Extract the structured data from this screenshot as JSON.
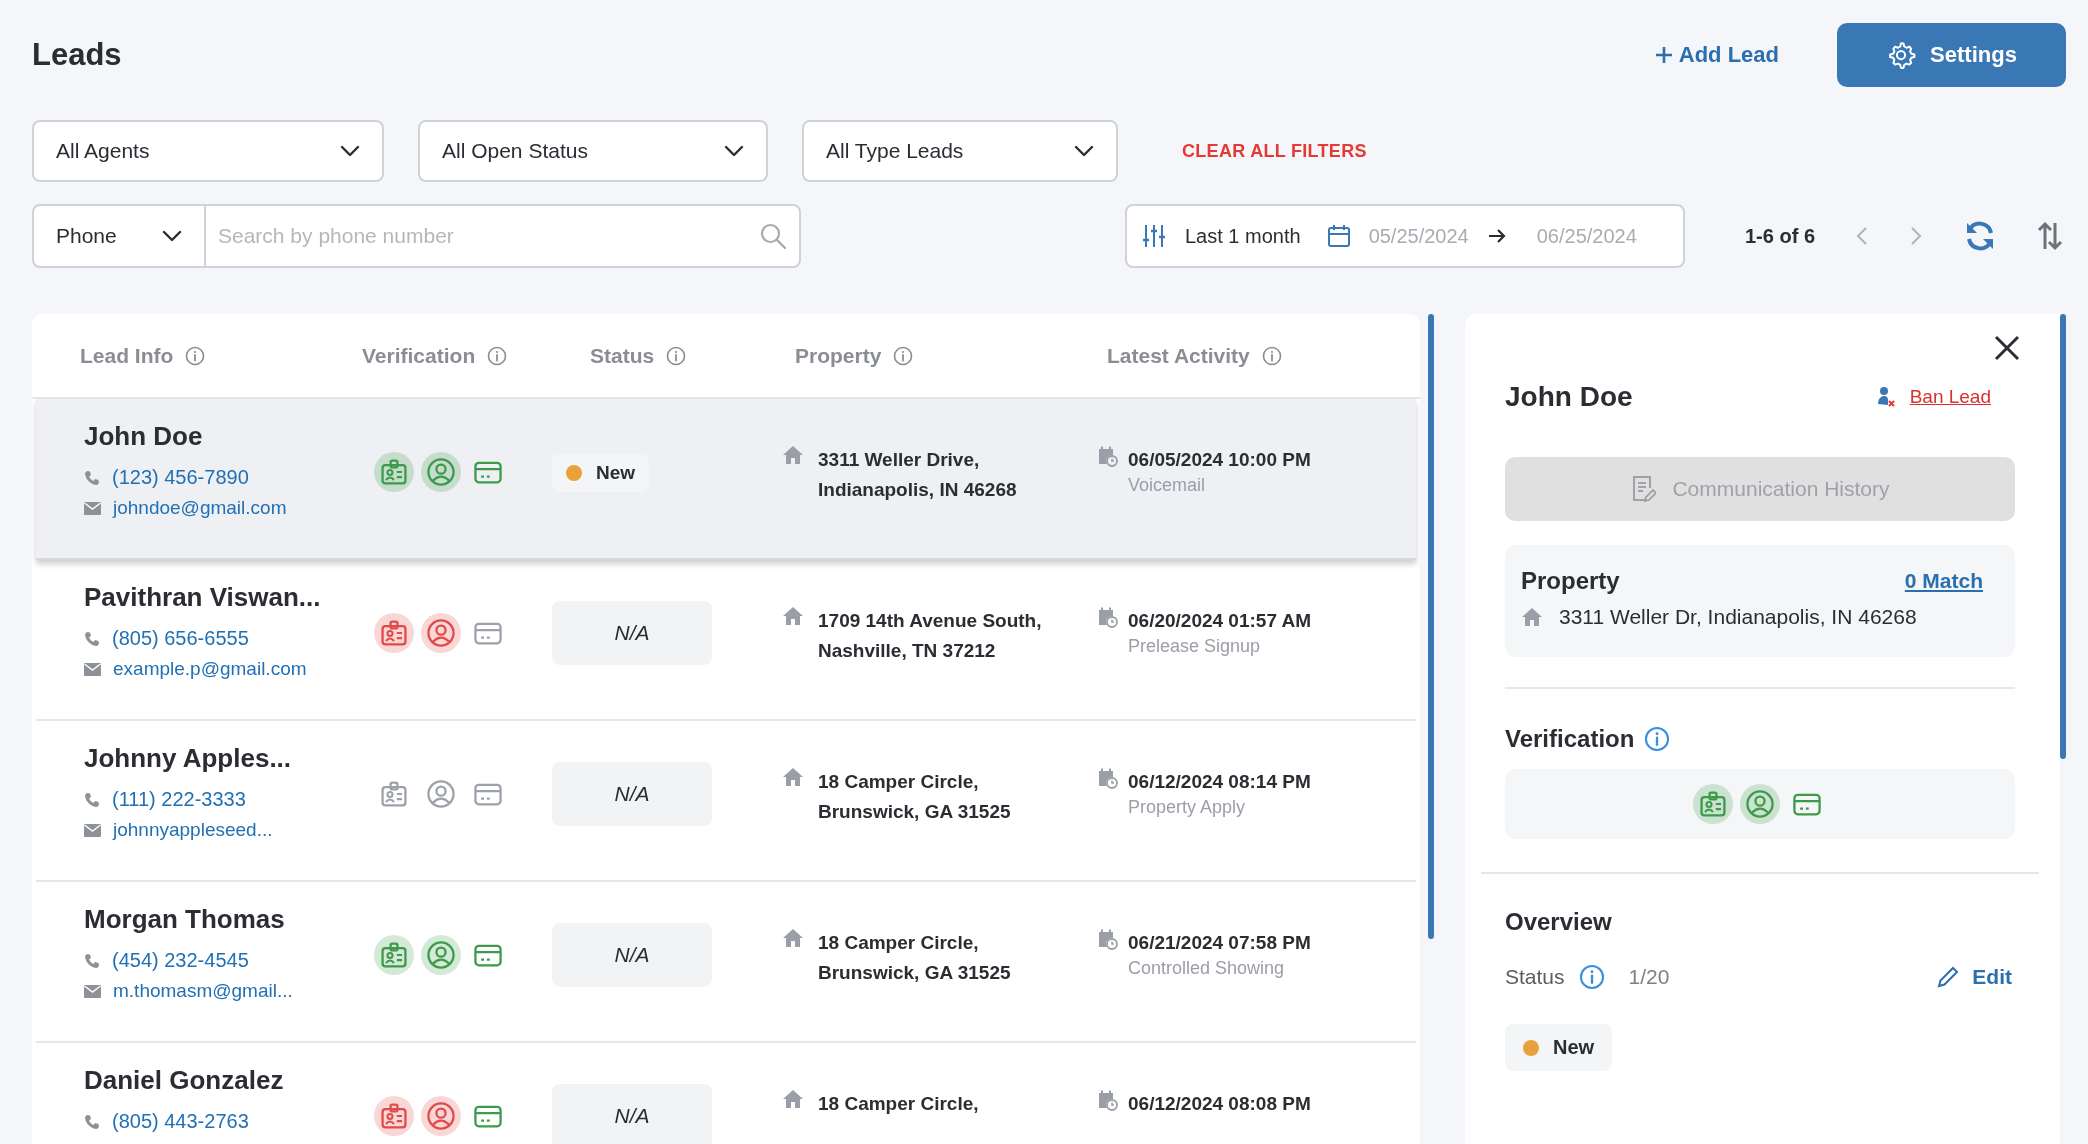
{
  "page": {
    "title": "Leads"
  },
  "actions": [
    {
      "kind": "link",
      "label": "Add Lead"
    },
    {
      "kind": "primary",
      "label": "Settings"
    }
  ],
  "filters": [
    {
      "value": "All Agents"
    },
    {
      "value": "All Open Status"
    },
    {
      "value": "All Type Leads"
    }
  ],
  "clear_filters": "CLEAR ALL FILTERS",
  "search": {
    "field_type": "Phone",
    "placeholder": "Search by phone number"
  },
  "date_range": {
    "preset": "Last 1 month",
    "start": "05/25/2024",
    "end": "06/25/2024"
  },
  "pagination": {
    "range": "1-6 of 6"
  },
  "table": {
    "columns": [
      "Lead Info",
      "Verification",
      "Status",
      "Property",
      "Latest Activity"
    ],
    "rows": [
      {
        "selected": true,
        "name": "John Doe",
        "phone": "(123) 456-7890",
        "email": "johndoe@gmail.com",
        "verification": [
          {
            "kind": "id",
            "color": "#3d9a4a",
            "highlighted": true
          },
          {
            "kind": "person",
            "color": "#3d9a4a",
            "highlighted": true
          },
          {
            "kind": "card",
            "color": "#3d9a4a",
            "highlighted": false
          }
        ],
        "status": {
          "kind": "badge",
          "label": "New",
          "color": "#e9a23b"
        },
        "address": [
          "3311 Weller Drive,",
          "Indianapolis, IN 46268"
        ],
        "activity_time": "06/05/2024 10:00 PM",
        "activity_type": "Voicemail"
      },
      {
        "selected": false,
        "name": "Pavithran Viswan...",
        "phone": "(805) 656-6555",
        "email": "example.p@gmail.com",
        "verification": [
          {
            "kind": "id",
            "color": "#e24a4a",
            "highlighted": true
          },
          {
            "kind": "person",
            "color": "#e24a4a",
            "highlighted": true
          },
          {
            "kind": "card",
            "color": "#9ca1aa",
            "highlighted": false
          }
        ],
        "status": {
          "kind": "empty",
          "label": "N/A"
        },
        "address": [
          "1709 14th Avenue South,",
          "Nashville, TN 37212"
        ],
        "activity_time": "06/20/2024 01:57 AM",
        "activity_type": "Prelease Signup"
      },
      {
        "selected": false,
        "name": "Johnny Apples...",
        "phone": "(111) 222-3333",
        "email": "johnnyappleseed...",
        "verification": [
          {
            "kind": "id",
            "color": "#9ca1aa",
            "highlighted": false
          },
          {
            "kind": "person",
            "color": "#9ca1aa",
            "highlighted": false
          },
          {
            "kind": "card",
            "color": "#9ca1aa",
            "highlighted": false
          }
        ],
        "status": {
          "kind": "empty",
          "label": "N/A"
        },
        "address": [
          "18 Camper Circle,",
          "Brunswick, GA 31525"
        ],
        "activity_time": "06/12/2024 08:14 PM",
        "activity_type": "Property Apply"
      },
      {
        "selected": false,
        "name": "Morgan Thomas",
        "phone": "(454) 232-4545",
        "email": "m.thomasm@gmail...",
        "verification": [
          {
            "kind": "id",
            "color": "#3d9a4a",
            "highlighted": true
          },
          {
            "kind": "person",
            "color": "#3d9a4a",
            "highlighted": true
          },
          {
            "kind": "card",
            "color": "#3d9a4a",
            "highlighted": false
          }
        ],
        "status": {
          "kind": "empty",
          "label": "N/A"
        },
        "address": [
          "18 Camper Circle,",
          "Brunswick, GA 31525"
        ],
        "activity_time": "06/21/2024 07:58 PM",
        "activity_type": "Controlled Showing"
      },
      {
        "selected": false,
        "name": "Daniel Gonzalez",
        "phone": "(805) 443-2763",
        "verification": [
          {
            "kind": "id",
            "color": "#e24a4a",
            "highlighted": true
          },
          {
            "kind": "person",
            "color": "#e24a4a",
            "highlighted": true
          },
          {
            "kind": "card",
            "color": "#3d9a4a",
            "highlighted": false
          }
        ],
        "status": {
          "kind": "empty",
          "label": "N/A"
        },
        "address": [
          "18 Camper Circle,"
        ],
        "activity_time": "06/12/2024 08:08 PM"
      }
    ]
  },
  "details": {
    "name": "John Doe",
    "ban": "Ban Lead",
    "history_button": {
      "label": "Communication History",
      "disabled": true
    },
    "property": {
      "title": "Property",
      "match": "0 Match",
      "address": "3311 Weller Dr, Indianapolis, IN 46268"
    },
    "verification": {
      "title": "Verification",
      "items": [
        {
          "kind": "id",
          "color": "#3d9a4a",
          "highlighted": true
        },
        {
          "kind": "person",
          "color": "#3d9a4a",
          "highlighted": true
        },
        {
          "kind": "card",
          "color": "#3d9a4a",
          "highlighted": false
        }
      ]
    },
    "overview": {
      "title": "Overview",
      "status_label": "Status",
      "count": "1/20",
      "edit": "Edit",
      "status": {
        "kind": "badge",
        "label": "New",
        "color": "#e9a23b"
      }
    }
  }
}
